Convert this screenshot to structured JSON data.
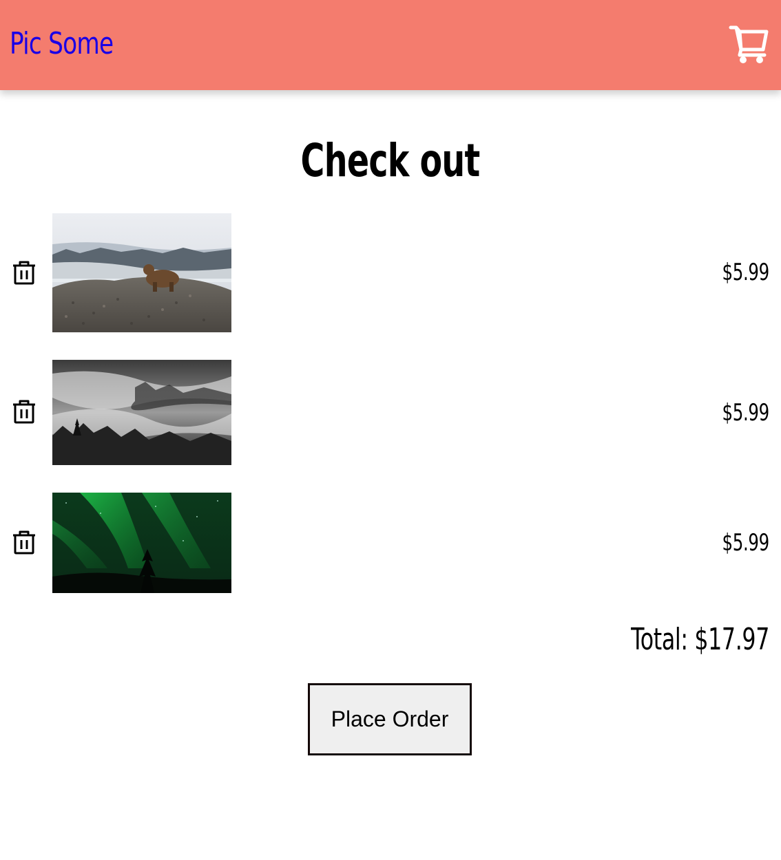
{
  "header": {
    "brand": "Pic Some",
    "cart_icon": "cart-icon",
    "background_color": "#f47c6e",
    "brand_color": "#1a00e6"
  },
  "page": {
    "title": "Check out"
  },
  "cart_items": [
    {
      "price": "$5.99",
      "image_description": "bear on rocky hillside",
      "remove_icon": "trash-icon"
    },
    {
      "price": "$5.99",
      "image_description": "misty forest valley, black and white",
      "remove_icon": "trash-icon"
    },
    {
      "price": "$5.99",
      "image_description": "green aurora over tree silhouette",
      "remove_icon": "trash-icon"
    }
  ],
  "summary": {
    "total_text": "Total: $17.97"
  },
  "actions": {
    "place_order_label": "Place Order"
  }
}
